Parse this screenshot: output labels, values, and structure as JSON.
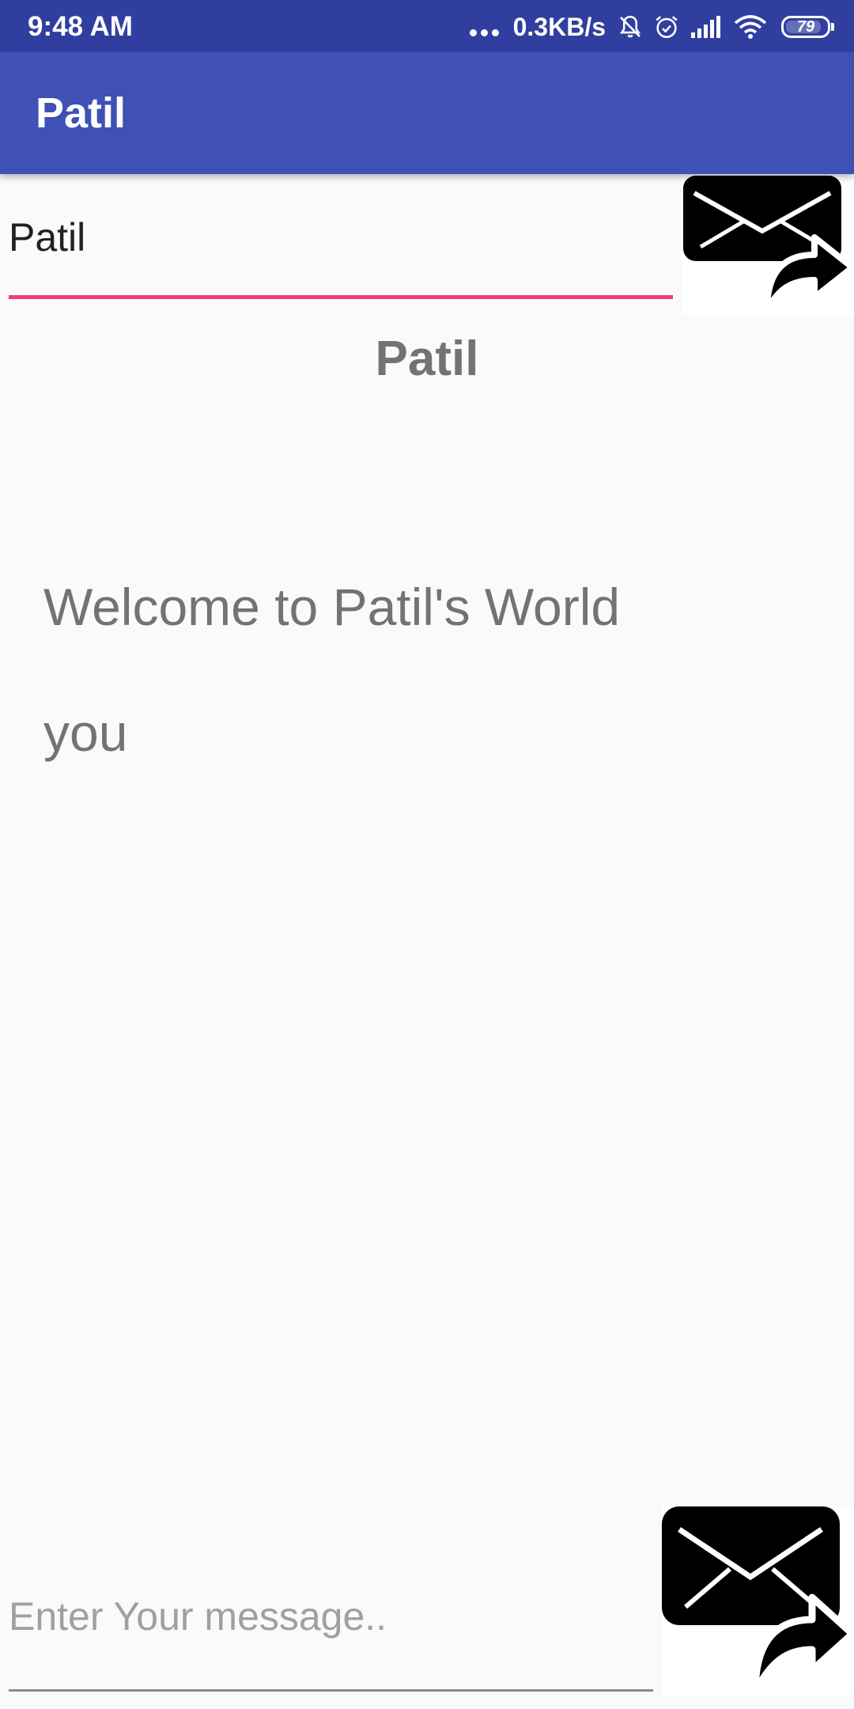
{
  "status_bar": {
    "time": "9:48 AM",
    "network_speed": "0.3KB/s",
    "battery_level": "79",
    "icons": [
      "more-dots-icon",
      "mute-bell-icon",
      "alarm-icon",
      "signal-icon",
      "wifi-icon",
      "battery-icon"
    ]
  },
  "app_bar": {
    "title": "Patil"
  },
  "name_input": {
    "value": "Patil",
    "accent_color": "#ec407a"
  },
  "display": {
    "title": "Patil",
    "welcome": "Welcome to Patil's World",
    "message": "you"
  },
  "message_input": {
    "placeholder": "Enter Your message..",
    "value": ""
  },
  "send_buttons": {
    "icon": "mail-send-icon"
  },
  "colors": {
    "status_bar": "#303f9f",
    "app_bar": "#3f51b5",
    "background": "#fafafa",
    "text_gray": "#737373"
  }
}
